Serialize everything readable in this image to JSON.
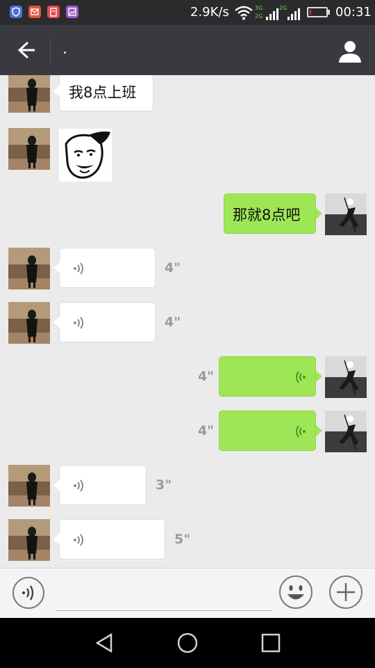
{
  "status_bar": {
    "speed": "2.9K/s",
    "time": "00:31",
    "network_labels": [
      "3G",
      "2G",
      "2G"
    ],
    "battery_percent": 10,
    "app_icons": [
      "shield-icon",
      "mail-icon",
      "clipboard-icon",
      "gallery-icon"
    ]
  },
  "header": {
    "title": ".",
    "back_icon": "arrow-left-icon",
    "contact_icon": "person-icon"
  },
  "messages": [
    {
      "side": "left",
      "type": "text",
      "text": "我8点上班"
    },
    {
      "side": "left",
      "type": "sticker"
    },
    {
      "side": "right",
      "type": "text",
      "text": "那就8点吧"
    },
    {
      "side": "left",
      "type": "voice",
      "duration": "4\""
    },
    {
      "side": "left",
      "type": "voice",
      "duration": "4\""
    },
    {
      "side": "right",
      "type": "voice",
      "duration": "4\""
    },
    {
      "side": "right",
      "type": "voice",
      "duration": "4\""
    },
    {
      "side": "left",
      "type": "voice",
      "duration": "3\""
    },
    {
      "side": "left",
      "type": "voice",
      "duration": "5\""
    }
  ],
  "input_bar": {
    "placeholder": "",
    "value": "",
    "icons": [
      "voice-toggle-icon",
      "emoji-icon",
      "plus-icon"
    ]
  },
  "nav_bar": {
    "icons": [
      "back-triangle-icon",
      "home-circle-icon",
      "recents-square-icon"
    ]
  },
  "colors": {
    "status_bg": "#2b2b2d",
    "header_bg": "#393a3f",
    "chat_bg": "#ebebeb",
    "sent_bubble": "#9fe657",
    "received_bubble": "#ffffff",
    "voice_icon_green": "#3a9a2a",
    "duration_gray": "#9a9a9a"
  }
}
